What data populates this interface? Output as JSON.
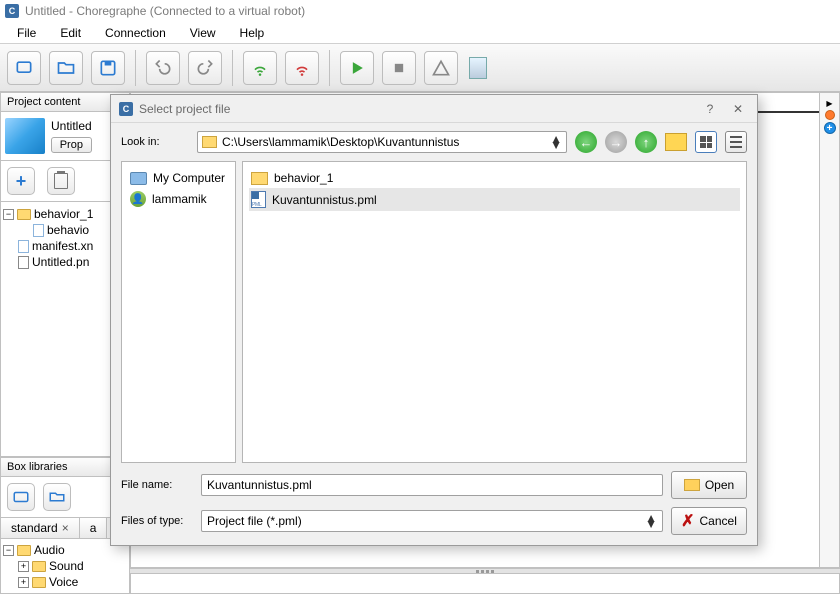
{
  "window": {
    "title": "Untitled - Choregraphe (Connected to a virtual robot)"
  },
  "menu": {
    "file": "File",
    "edit": "Edit",
    "connection": "Connection",
    "view": "View",
    "help": "Help"
  },
  "panels": {
    "project_content": "Project content",
    "box_libraries": "Box libraries"
  },
  "project": {
    "name": "Untitled",
    "prop_btn": "Prop",
    "tree": {
      "behavior_folder": "behavior_1",
      "behavior_file": "behavio",
      "manifest": "manifest.xn",
      "untitled_pml": "Untitled.pn"
    }
  },
  "boxlib": {
    "tab_standard": "standard",
    "tab_a": "a",
    "tree": {
      "audio": "Audio",
      "sound": "Sound",
      "voice": "Voice"
    }
  },
  "dialog": {
    "title": "Select project file",
    "look_in_label": "Look in:",
    "path": "C:\\Users\\lammamik\\Desktop\\Kuvantunnistus",
    "left_items": {
      "my_computer": "My Computer",
      "user": "lammamik"
    },
    "right_items": {
      "folder1": "behavior_1",
      "pml": "Kuvantunnistus.pml"
    },
    "file_name_label": "File name:",
    "file_name_value": "Kuvantunnistus.pml",
    "file_type_label": "Files of type:",
    "file_type_value": "Project file (*.pml)",
    "open": "Open",
    "cancel": "Cancel",
    "help": "?"
  }
}
